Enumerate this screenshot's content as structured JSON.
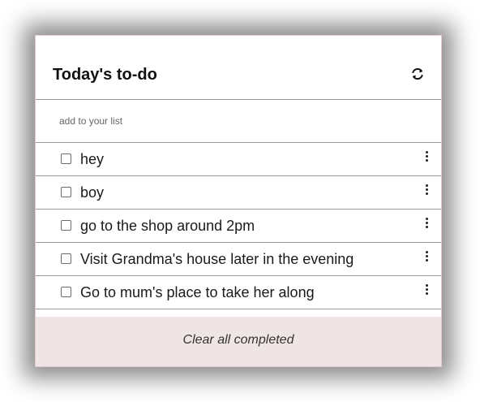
{
  "header": {
    "title": "Today's to-do",
    "refresh_icon": "refresh-icon"
  },
  "add": {
    "placeholder": "add to your list",
    "value": ""
  },
  "items": [
    {
      "label": "hey",
      "checked": false
    },
    {
      "label": "boy",
      "checked": false
    },
    {
      "label": "go to the shop around 2pm",
      "checked": false
    },
    {
      "label": "Visit Grandma's house later in the evening",
      "checked": false
    },
    {
      "label": "Go to mum's place to take her along",
      "checked": false
    }
  ],
  "footer": {
    "clear_label": "Clear all completed"
  }
}
